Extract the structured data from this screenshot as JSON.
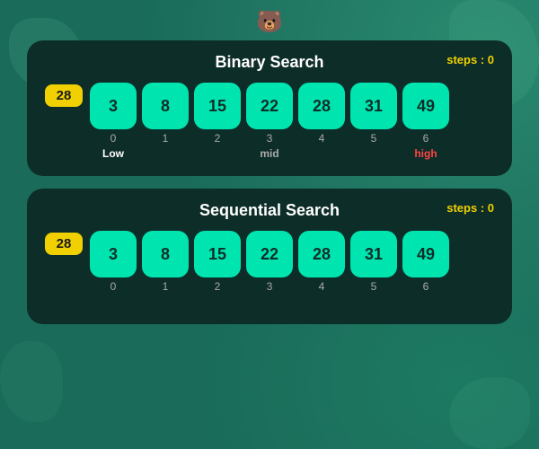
{
  "app": {
    "bear_icon": "🐻",
    "background_color": "#1a6b5a"
  },
  "binary_search": {
    "title": "Binary Search",
    "steps_label": "steps : 0",
    "target": 28,
    "items": [
      {
        "value": 3,
        "index": 0,
        "label": "Low",
        "label_class": "label-low"
      },
      {
        "value": 8,
        "index": 1,
        "label": "",
        "label_class": ""
      },
      {
        "value": 15,
        "index": 2,
        "label": "",
        "label_class": ""
      },
      {
        "value": 22,
        "index": 3,
        "label": "mid",
        "label_class": "label-mid"
      },
      {
        "value": 28,
        "index": 4,
        "label": "",
        "label_class": ""
      },
      {
        "value": 31,
        "index": 5,
        "label": "",
        "label_class": ""
      },
      {
        "value": 49,
        "index": 6,
        "label": "high",
        "label_class": "label-high"
      }
    ]
  },
  "sequential_search": {
    "title": "Sequential Search",
    "steps_label": "steps : 0",
    "target": 28,
    "items": [
      {
        "value": 3,
        "index": 0,
        "label": "",
        "label_class": ""
      },
      {
        "value": 8,
        "index": 1,
        "label": "",
        "label_class": ""
      },
      {
        "value": 15,
        "index": 2,
        "label": "",
        "label_class": ""
      },
      {
        "value": 22,
        "index": 3,
        "label": "",
        "label_class": ""
      },
      {
        "value": 28,
        "index": 4,
        "label": "",
        "label_class": ""
      },
      {
        "value": 31,
        "index": 5,
        "label": "",
        "label_class": ""
      },
      {
        "value": 49,
        "index": 6,
        "label": "",
        "label_class": ""
      }
    ]
  }
}
